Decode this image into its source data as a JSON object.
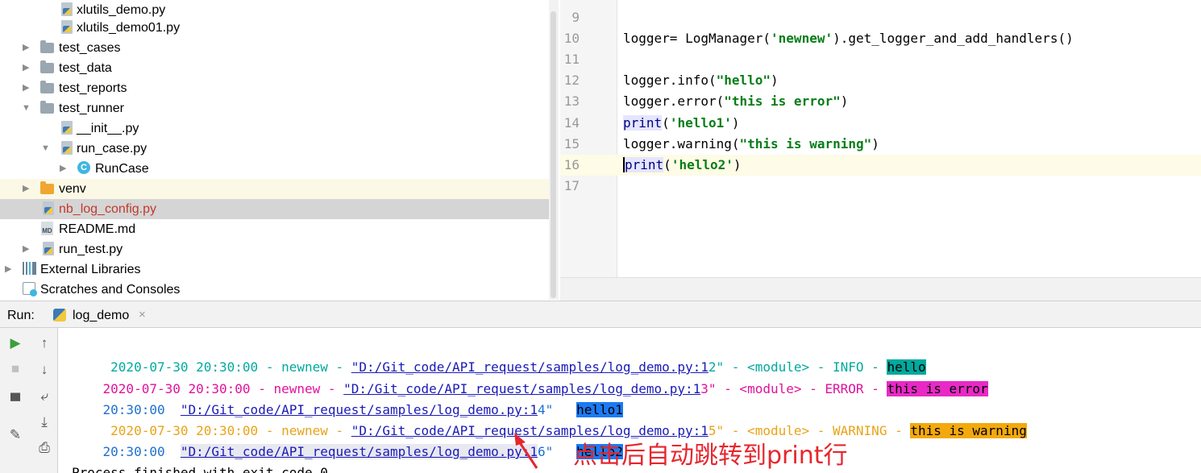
{
  "project_tree": {
    "items": [
      {
        "label": "xlutils_demo.py",
        "icon": "python-file-icon"
      },
      {
        "label": "xlutils_demo01.py",
        "icon": "python-file-icon"
      },
      {
        "label": "test_cases",
        "icon": "folder-icon"
      },
      {
        "label": "test_data",
        "icon": "folder-icon"
      },
      {
        "label": "test_reports",
        "icon": "folder-icon"
      },
      {
        "label": "test_runner",
        "icon": "folder-icon"
      },
      {
        "label": "__init__.py",
        "icon": "python-file-icon"
      },
      {
        "label": "run_case.py",
        "icon": "python-file-icon"
      },
      {
        "label": "RunCase",
        "icon": "class-icon",
        "icon_letter": "C"
      },
      {
        "label": "venv",
        "icon": "excluded-folder-icon"
      },
      {
        "label": "nb_log_config.py",
        "icon": "python-file-icon",
        "label_color": "#c0392b"
      },
      {
        "label": "README.md",
        "icon": "markdown-file-icon",
        "icon_text": "MD"
      },
      {
        "label": "run_test.py",
        "icon": "python-file-icon"
      },
      {
        "label": "External Libraries",
        "icon": "libraries-icon"
      },
      {
        "label": "Scratches and Consoles",
        "icon": "scratches-icon"
      }
    ]
  },
  "editor": {
    "lines": [
      {
        "n": "9",
        "code": ""
      },
      {
        "n": "10",
        "code": "logger= LogManager('newnew').get_logger_and_add_handlers()"
      },
      {
        "n": "11",
        "code": ""
      },
      {
        "n": "12",
        "code": "logger.info(\"hello\")"
      },
      {
        "n": "13",
        "code": "logger.error(\"this is error\")"
      },
      {
        "n": "14",
        "code": "print('hello1')"
      },
      {
        "n": "15",
        "code": "logger.warning(\"this is warning\")"
      },
      {
        "n": "16",
        "code": "print('hello2')"
      },
      {
        "n": "17",
        "code": ""
      }
    ]
  },
  "run_panel": {
    "label": "Run:",
    "tab_label": "log_demo",
    "close_glyph": "×"
  },
  "console": {
    "lines": [
      {
        "prefix": " 2020-07-30 20:30:00 - newnew - ",
        "link": "\"D:/Git_code/API_request/samples/log_demo.py:1",
        "suffix": "2\" - <module> - INFO - ",
        "message": "hello",
        "level": "info"
      },
      {
        "prefix": "2020-07-30 20:30:00 - newnew - ",
        "link": "\"D:/Git_code/API_request/samples/log_demo.py:1",
        "suffix": "3\" - <module> - ERROR - ",
        "message": "this is error",
        "level": "error"
      },
      {
        "prefix": "20:30:00  ",
        "link": "\"D:/Git_code/API_request/samples/log_demo.py:1",
        "suffix": "4\"   ",
        "message": "hello1",
        "level": "print"
      },
      {
        "prefix": " 2020-07-30 20:30:00 - newnew - ",
        "link": "\"D:/Git_code/API_request/samples/log_demo.py:1",
        "suffix": "5\" - <module> - WARNING - ",
        "message": "this is warning",
        "level": "warning"
      },
      {
        "prefix": "20:30:00  ",
        "link": "\"D:/Git_code/API_request/samples/log_demo.py:1",
        "suffix": "6\"   ",
        "message": "hello2",
        "level": "print"
      }
    ],
    "partial_last_line": "Process finished with exit code 0"
  },
  "annotation": {
    "text": "点击后自动跳转到print行",
    "color": "#e6262d"
  },
  "colors": {
    "info": "#00a99d",
    "error": "#e829c6",
    "print": "#1d7af3",
    "warning": "#f3a90e",
    "link": "#1a1ab8"
  }
}
